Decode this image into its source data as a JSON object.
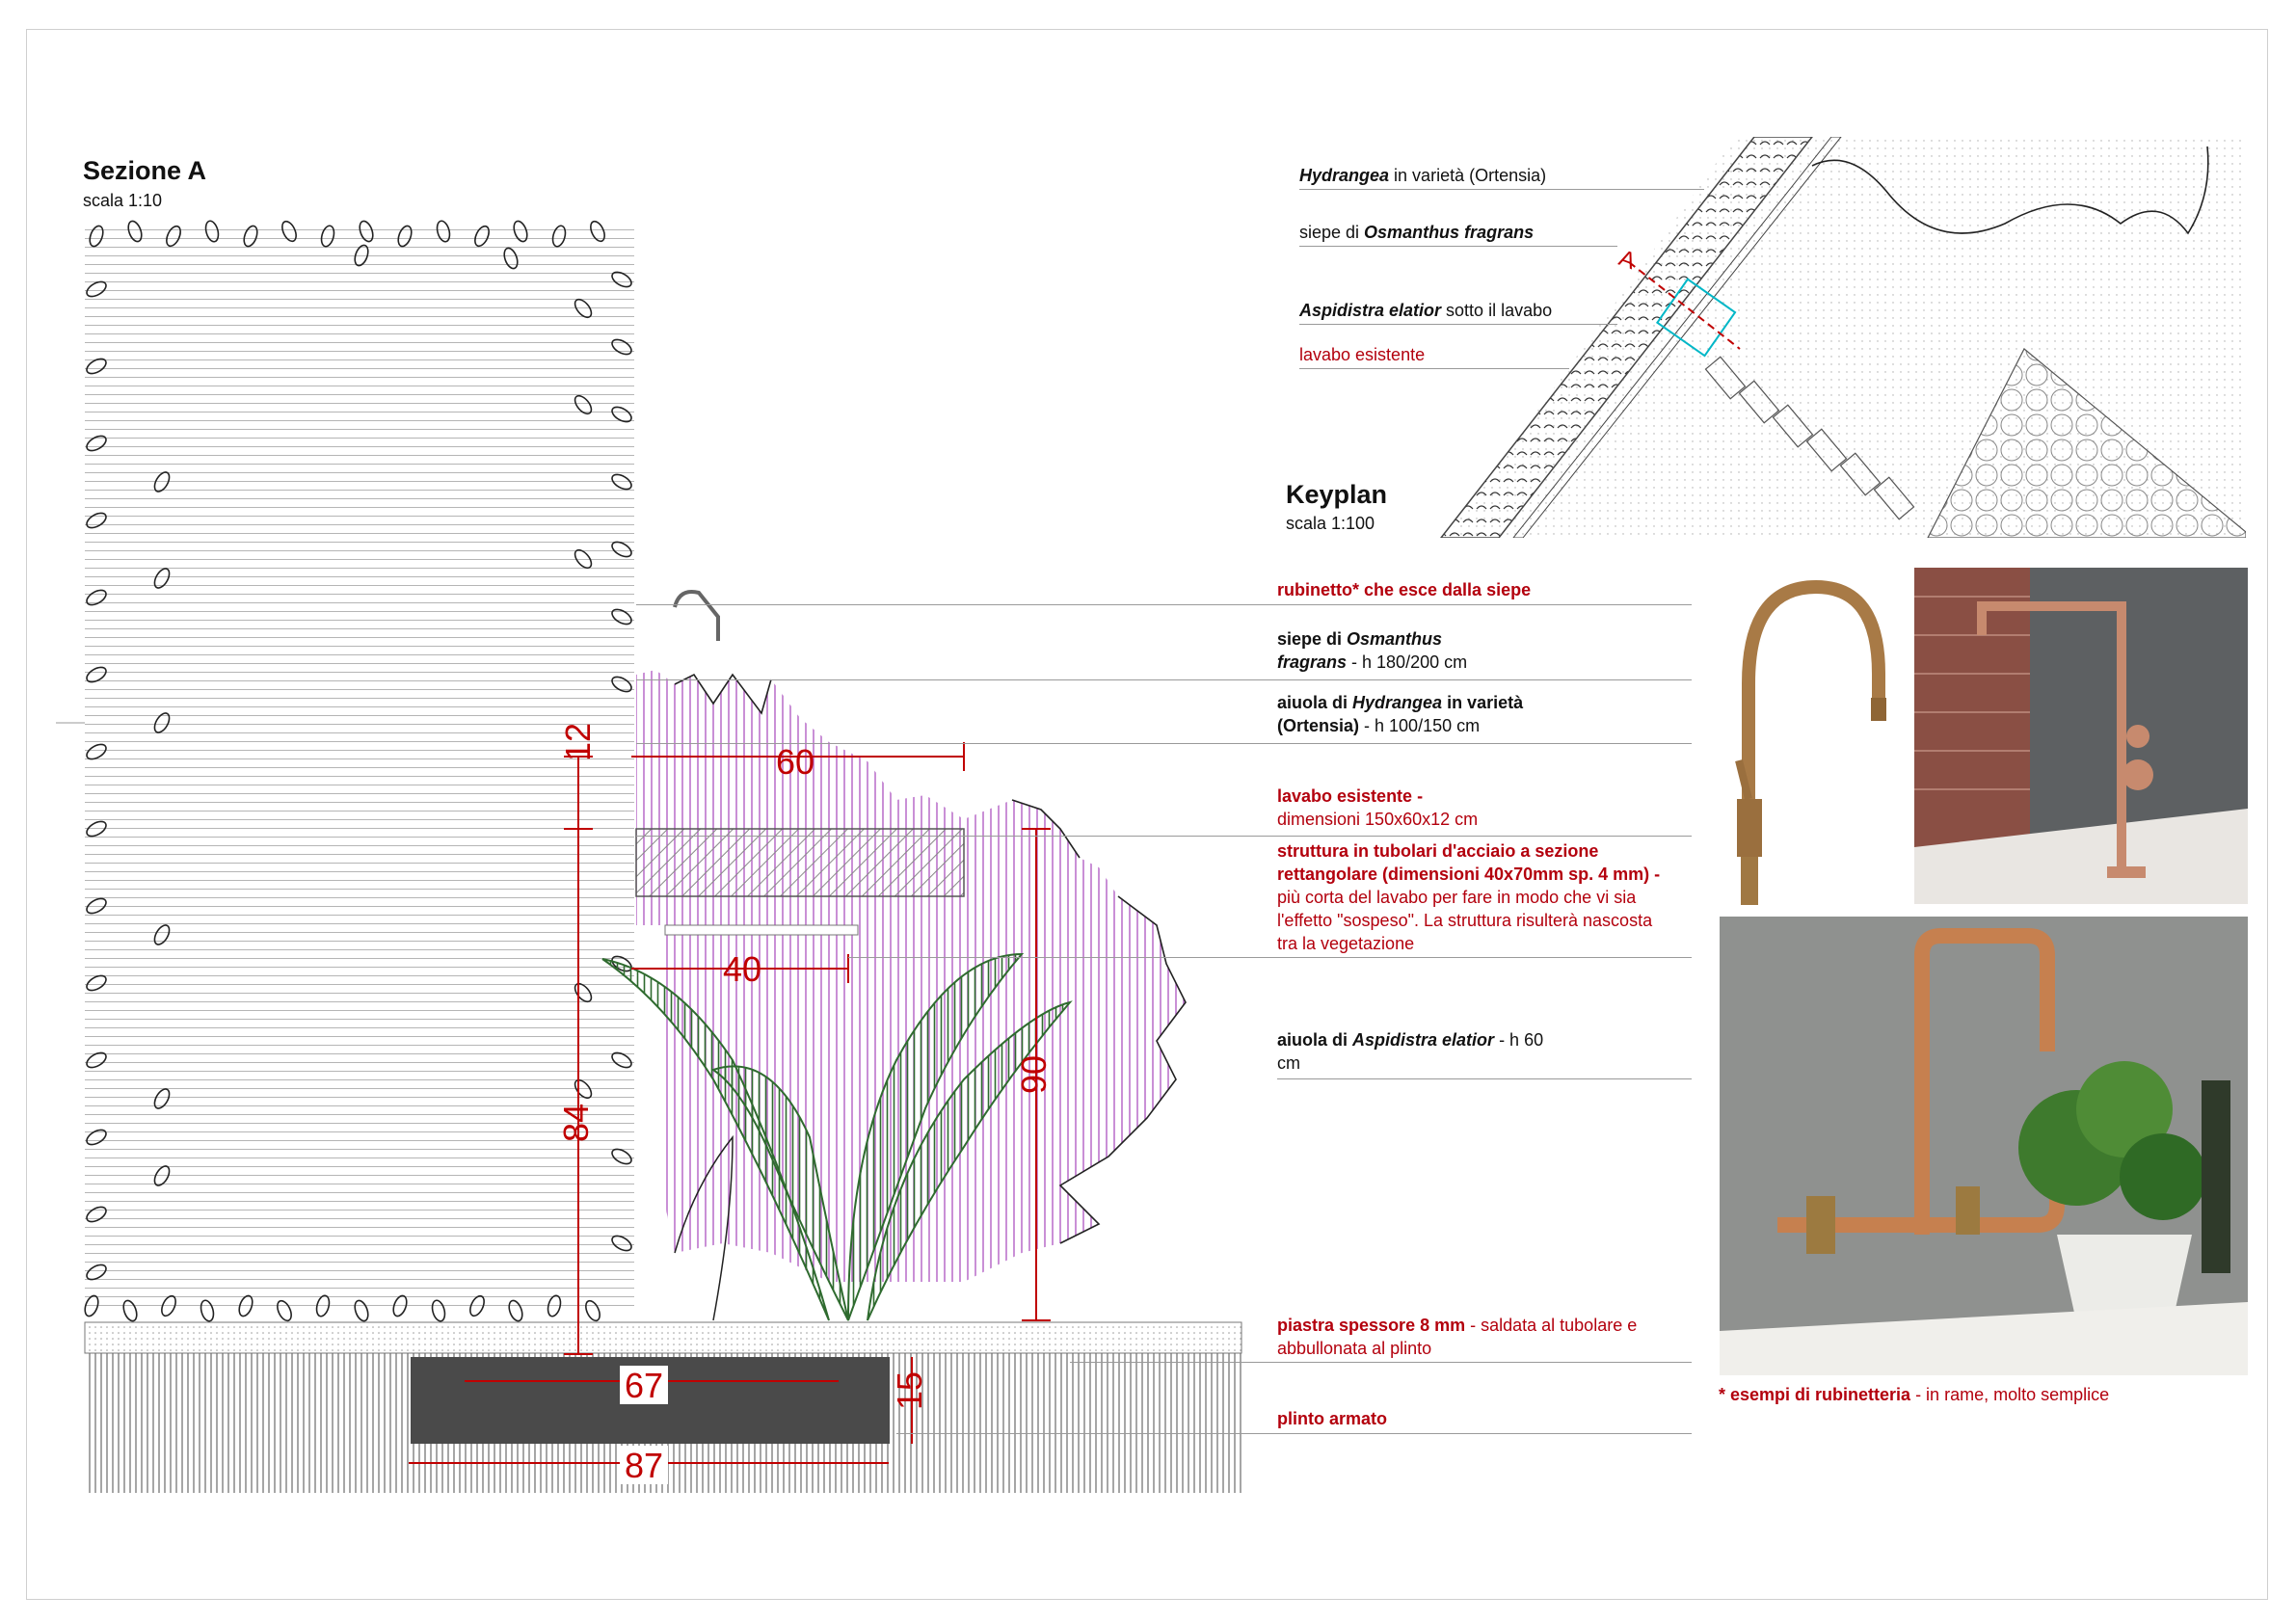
{
  "section": {
    "title": "Sezione A",
    "scale": "scala 1:10"
  },
  "keyplan": {
    "title": "Keyplan",
    "scale": "scala 1:100",
    "section_marker": "A",
    "labels": [
      {
        "name_it": "Hydrangea",
        "rest": " in varietà (Ortensia)"
      },
      {
        "pre": "siepe di ",
        "name_it": "Osmanthus fragrans"
      },
      {
        "name_it": "Aspidistra elatior",
        "rest": " sotto il lavabo"
      },
      {
        "text": "lavabo esistente"
      }
    ]
  },
  "dimensions": {
    "d12": "12",
    "d60": "60",
    "d40": "40",
    "d84": "84",
    "d90": "90",
    "d67": "67",
    "d15": "15",
    "d87": "87"
  },
  "notes": {
    "rubinetto": "rubinetto* che esce dalla siepe",
    "siepe_pre": "siepe di ",
    "siepe_name1": "Osmanthus",
    "siepe_name2": "fragrans",
    "siepe_rest": " - h 180/200 cm",
    "aiuola1_pre": "aiuola di ",
    "aiuola1_name": "Hydrangea",
    "aiuola1_mid": " in varietà",
    "aiuola1_b2": "(Ortensia)",
    "aiuola1_rest": " - h 100/150 cm",
    "lavabo_title": "lavabo esistente -",
    "lavabo_dim": "dimensioni 150x60x12 cm",
    "struttura_b1": "struttura in tubolari d'acciaio a sezione",
    "struttura_b2": "rettangolare (dimensioni 40x70mm sp. 4 mm) -",
    "struttura_l3": "più corta del lavabo per fare in modo che vi sia",
    "struttura_l4": "l'effetto \"sospeso\". La struttura risulterà nascosta",
    "struttura_l5": "tra la vegetazione",
    "aiuola2_pre": "aiuola di ",
    "aiuola2_name": "Aspidistra elatior",
    "aiuola2_rest": " - h 60",
    "aiuola2_l2": "cm",
    "piastra_b": "piastra spessore 8 mm",
    "piastra_rest": " - saldata al tubolare e",
    "piastra_l2": "abbullonata al plinto",
    "plinto": "plinto armato",
    "esempi_b": "* esempi di rubinetteria",
    "esempi_rest": " - in rame, molto semplice"
  },
  "colors": {
    "annotation_red": "#b3000d",
    "dimension_red": "#c00000",
    "hedge_purple": "#b25fc4",
    "leaf_green": "#2f6b2f",
    "copper": "#b87333",
    "footing_dark": "#4a4a4a"
  },
  "photos": [
    {
      "subject": "brass gooseneck tap",
      "icon": "faucet-photo"
    },
    {
      "subject": "copper tall basin mixer on brick and concrete wall",
      "icon": "faucet-photo"
    },
    {
      "subject": "copper pipe wall tap with basil plant",
      "icon": "faucet-photo"
    }
  ]
}
